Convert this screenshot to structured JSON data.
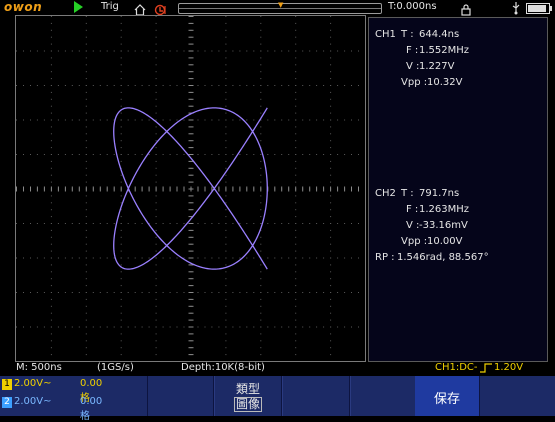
{
  "topbar": {
    "logo": "owon",
    "trigger_label": "Trig",
    "trigger_position_marker": "▼",
    "time_position": "T:0.000ns"
  },
  "xy_plot": {
    "mode": "XY",
    "trace_color": "#9a80ff",
    "ch1_amplitude_fraction": 0.88,
    "ch2_amplitude_fraction": 0.85,
    "ch1_frequency_mhz": 1.552,
    "ch2_frequency_mhz": 1.263,
    "frequency_ratio": "5:4"
  },
  "info_panel": {
    "ch1": {
      "name": "CH1",
      "period_label": "T :",
      "period_value": "644.4ns",
      "freq_label": "F :",
      "freq_value": "1.552MHz",
      "volt_label": "V :",
      "volt_value": "1.227V",
      "vpp_label": "Vpp :",
      "vpp_value": "10.32V"
    },
    "ch2": {
      "name": "CH2",
      "period_label": "T :",
      "period_value": "791.7ns",
      "freq_label": "F :",
      "freq_value": "1.263MHz",
      "volt_label": "V :",
      "volt_value": "-33.16mV",
      "vpp_label": "Vpp :",
      "vpp_value": "10.00V"
    },
    "phase": {
      "label": "RP :",
      "value": "1.546rad, 88.567°"
    }
  },
  "status": {
    "timebase": "M: 500ns",
    "sample_rate": "(1GS/s)",
    "depth": "Depth:10K(8-bit)",
    "trigger_info": "CH1:DC-",
    "trigger_level": "1.20V"
  },
  "channels": [
    {
      "num": "1",
      "scale": "2.00V~",
      "offset": "0.00格",
      "color": "#f0d000"
    },
    {
      "num": "2",
      "scale": "2.00V~",
      "offset": "0.00格",
      "color": "#3ca0ff"
    }
  ],
  "menu": {
    "type_label": "類型",
    "type_value": "圖像",
    "save_label": "保存"
  }
}
